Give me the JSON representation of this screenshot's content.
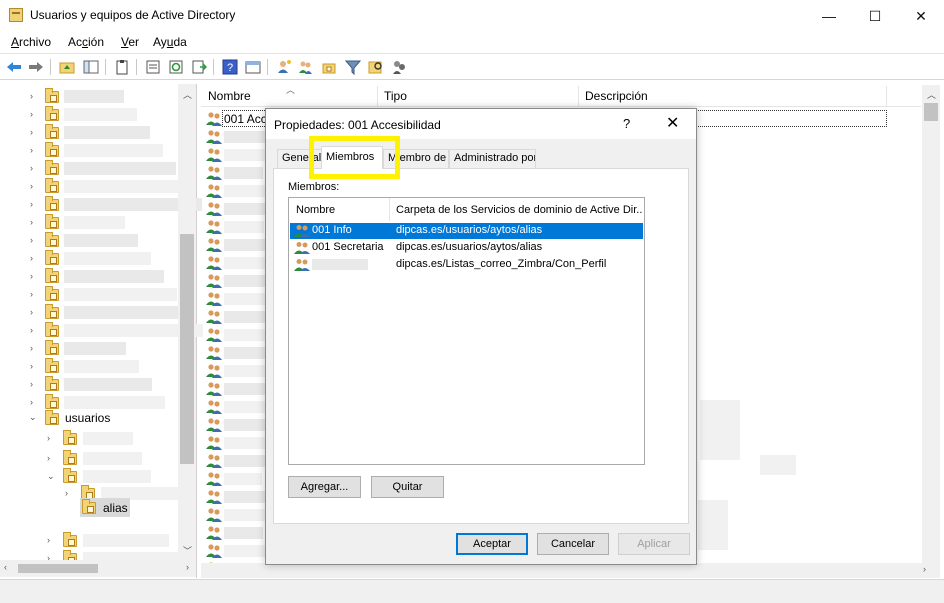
{
  "window": {
    "title": "Usuarios y equipos de Active Directory",
    "minimize": "—",
    "maximize": "☐",
    "close": "✕"
  },
  "menu": {
    "items": [
      {
        "label_pre": "",
        "label_u": "A",
        "label_post": "rchivo"
      },
      {
        "label_pre": "Ac",
        "label_u": "c",
        "label_post": "ión"
      },
      {
        "label_pre": "",
        "label_u": "V",
        "label_post": "er"
      },
      {
        "label_pre": "Ay",
        "label_u": "u",
        "label_post": "da"
      }
    ]
  },
  "toolbar": {
    "icons": [
      "back-arrow-icon",
      "forward-arrow-icon",
      "up-folder-icon",
      "show-tree-icon",
      "clipboard-icon",
      "properties-icon",
      "refresh-icon",
      "export-icon",
      "help-icon",
      "console-icon",
      "add-user-icon",
      "add-group-icon",
      "add-ou-icon",
      "filter-icon",
      "find-icon",
      "delegate-icon"
    ]
  },
  "tree": {
    "expanded_node": "usuarios",
    "selected_node": "alias"
  },
  "list": {
    "columns": [
      "Nombre",
      "Tipo",
      "Descripción"
    ],
    "first_row_name": "001 Acc"
  },
  "dialog": {
    "title": "Propiedades: 001 Accesibilidad",
    "help": "?",
    "close": "✕",
    "tabs": [
      "General",
      "Miembros",
      "Miembro de",
      "Administrado por"
    ],
    "active_tab": "Miembros",
    "members_label": "Miembros:",
    "columns": [
      "Nombre",
      "Carpeta de los Servicios de dominio de Active Dir..."
    ],
    "members": [
      {
        "name": "001 Info",
        "folder": "dipcas.es/usuarios/aytos/alias",
        "selected": true
      },
      {
        "name": "001 Secretaria",
        "folder": "dipcas.es/usuarios/aytos/alias",
        "selected": false
      },
      {
        "name": "",
        "folder": "dipcas.es/Listas_correo_Zimbra/Con_Perfil",
        "selected": false
      }
    ],
    "buttons": {
      "add": "Agregar...",
      "remove": "Quitar",
      "ok": "Aceptar",
      "cancel": "Cancelar",
      "apply": "Aplicar"
    }
  },
  "colors": {
    "selection": "#0078d7",
    "highlight_box": "#fff200",
    "folder": "#f3d377"
  }
}
